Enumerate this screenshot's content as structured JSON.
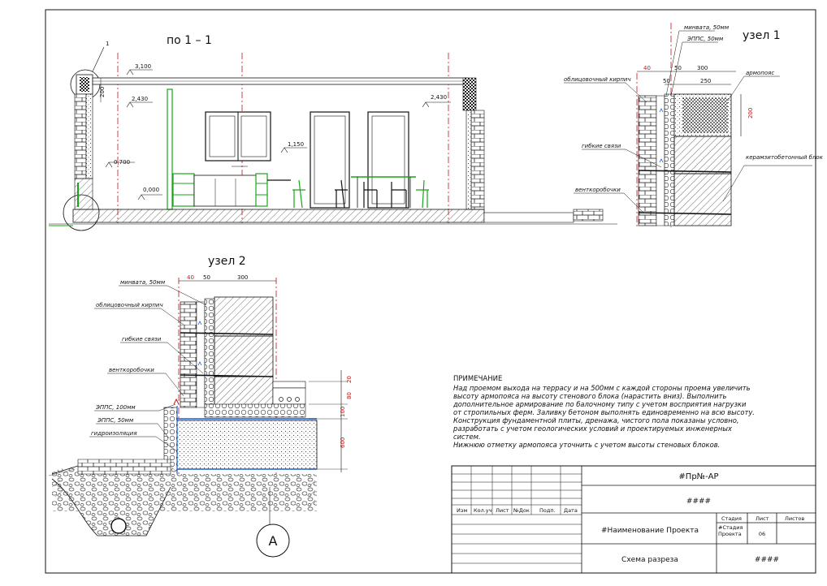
{
  "section": {
    "title": "по 1 – 1",
    "callout": "1",
    "levels": [
      "3,100",
      "2,430",
      "2,430",
      "1,150",
      "0,700",
      "0,000"
    ],
    "dim_200": "200"
  },
  "node1": {
    "title": "узел 1",
    "labels": {
      "mineral_wool": "минвата, 50мм",
      "xps": "ЭППС, 50мм",
      "facing_brick": "облицовочный кирпич",
      "belt": "армопояс",
      "ties": "гибкие связи",
      "vent": "венткоробочки",
      "block": "керамзитобетонный блок"
    },
    "dims": [
      "40",
      "50",
      "300",
      "50",
      "250",
      "200"
    ]
  },
  "node2": {
    "title": "узел 2",
    "labels": {
      "mineral_wool": "минвата, 50мм",
      "facing_brick": "облицовочный кирпич",
      "ties": "гибкие связи",
      "vent": "венткоробочки",
      "xps100": "ЭППС, 100мм",
      "xps50": "ЭППС, 50мм",
      "waterproofing": "гидроизоляция"
    },
    "dims": [
      "40",
      "50",
      "300",
      "20",
      "80",
      "100",
      "600"
    ],
    "axis": "А"
  },
  "notes": {
    "heading": "ПРИМЕЧАНИЕ",
    "lines": [
      "Над проемом выхода на террасу и на 500мм с каждой стороны проема увеличить",
      "высоту армопояса на высоту стенового блока (нарастить вниз). Выполнить",
      "дополнительное армирование по балочному типу с учетом восприятия нагрузки",
      "от стропильных ферм. Заливку бетоном выполнять единовременно на всю высоту.",
      "Конструкция фундаментной плиты, дренажа, чистого пола показаны условно,",
      "разработать с учетом геологических условий и проектируемых инженерных",
      "систем.",
      "Нижнюю отметку армопояса уточнить с учетом высоты стеновых блоков."
    ]
  },
  "title_block": {
    "code": "#Пр№-АР",
    "hash1": "####",
    "columns": [
      "Изм",
      "Кол.уч",
      "Лист",
      "№Док",
      "Подп.",
      "Дата"
    ],
    "project_name": "#Наименование Проекта",
    "stage_header": "Стадия",
    "sheet_header": "Лист",
    "sheets_header": "Листов",
    "stage_value": "#Стадия Проекта",
    "sheet_value": "06",
    "drawing_name": "Схема разреза",
    "hash2": "####"
  },
  "colors": {
    "line": "#111111",
    "accent_red": "#d01010",
    "green": "#1aa31a",
    "blue": "#1a5fd0"
  }
}
